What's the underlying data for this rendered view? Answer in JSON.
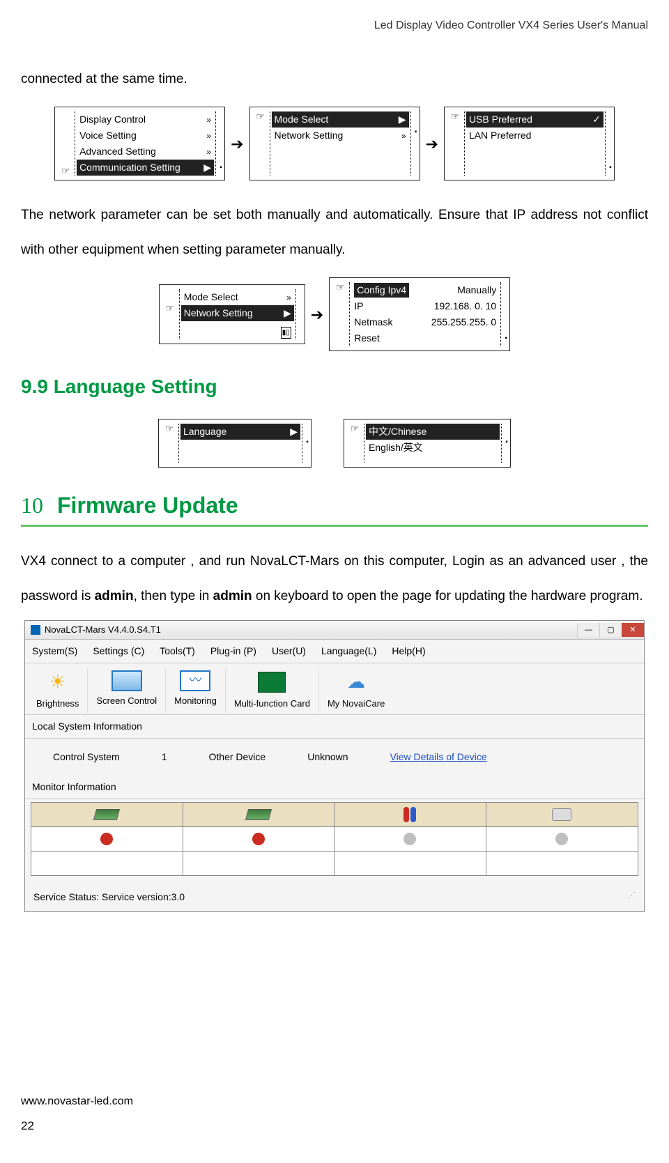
{
  "header": "Led Display Video Controller VX4 Series User's Manual",
  "para1": "connected at the same time.",
  "para2": "The network parameter can be set both manually and automatically. Ensure that IP address not conflict with other equipment when setting parameter manually.",
  "section99": "9.9 Language Setting",
  "chapter_num": "10",
  "chapter_text": "Firmware Update",
  "para3a": "VX4 connect to a computer , and run NovaLCT-Mars on this computer, Login as an advanced user , the password is ",
  "para3_bold1": "admin",
  "para3b": ", then type in ",
  "para3_bold2": "admin",
  "para3c": " on keyboard to open the page for updating the hardware program.",
  "menu1": {
    "i1": "Display Control",
    "i2": "Voice Setting",
    "i3": "Advanced Setting",
    "i4": "Communication Setting"
  },
  "menu2": {
    "i1": "Mode Select",
    "i2": "Network Setting"
  },
  "menu3": {
    "i1": "USB Preferred",
    "i2": "LAN Preferred"
  },
  "menu4": {
    "i1": "Mode Select",
    "i2": "Network Setting"
  },
  "menu5": {
    "r1l": "Config Ipv4",
    "r1r": "Manually",
    "r2l": "IP",
    "r2r": "192.168.  0. 10",
    "r3l": "Netmask",
    "r3r": "255.255.255.  0",
    "r4l": "Reset"
  },
  "menu6": {
    "i1": "Language"
  },
  "menu7": {
    "i1": "中文/Chinese",
    "i2": "English/英文"
  },
  "app": {
    "title": "NovaLCT-Mars V4.4.0.S4.T1",
    "menus": [
      "System(S)",
      "Settings (C)",
      "Tools(T)",
      "Plug-in (P)",
      "User(U)",
      "Language(L)",
      "Help(H)"
    ],
    "tools": [
      "Brightness",
      "Screen Control",
      "Monitoring",
      "Multi-function Card",
      "My NovaiCare"
    ],
    "local_sys": "Local System Information",
    "ctrl_sys_lbl": "Control System",
    "ctrl_sys_val": "1",
    "other_dev_lbl": "Other Device",
    "other_dev_val": "Unknown",
    "view_link": "View Details of Device",
    "monitor_hd": "Monitor Information",
    "service": "Service Status:  Service version:3.0"
  },
  "footer_url": "www.novastar-led.com",
  "page_no": "22"
}
